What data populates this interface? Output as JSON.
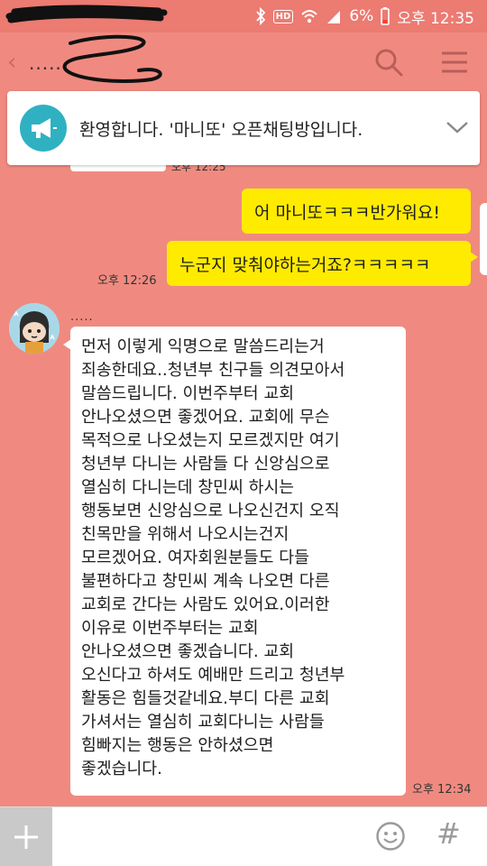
{
  "status_bar": {
    "battery": "6%",
    "time": "오후 12:35",
    "network_badge": "HD"
  },
  "header": {
    "title": ".....",
    "back_glyph": "‹",
    "icons": [
      "search-icon",
      "menu-icon"
    ]
  },
  "notice": {
    "text": "환영합니다. '마니또' 오픈채팅방입니다.",
    "icon": "megaphone-icon",
    "partial_time": "오후 12:25"
  },
  "messages_mine": [
    {
      "text": "어 마니또ㅋㅋㅋ반가워요!"
    },
    {
      "text": "누군지 맞춰야하는거죠?ㅋㅋㅋㅋㅋ",
      "time": "오후 12:26"
    }
  ],
  "message_other": {
    "sender": ".....",
    "lines": [
      "먼저 이렇게 익명으로 말씀드리는거",
      "죄송한데요..청년부 친구들 의견모아서",
      "말씀드립니다. 이번주부터 교회",
      "안나오셨으면 좋겠어요. 교회에 무슨",
      "목적으로 나오셨는지 모르겠지만 여기",
      "청년부 다니는 사람들 다 신앙심으로",
      "열심히 다니는데 창민씨 하시는",
      "행동보면 신앙심으로 나오신건지 오직",
      "친목만을 위해서 나오시는건지",
      "모르겠어요. 여자회원분들도 다들",
      "불편하다고 창민씨 계속 나오면 다른",
      "교회로 간다는 사람도 있어요.이러한",
      "이유로 이번주부터는 교회",
      "안나오셨으면 좋겠습니다. 교회",
      "오신다고 하셔도 예배만 드리고 청년부",
      "활동은 힘들것같네요.부디 다른 교회",
      "가셔서는 열심히 교회다니는 사람들",
      "힘빠지는 행동은 안하셨으면",
      "좋겠습니다."
    ],
    "time": "오후 12:34"
  },
  "input_bar": {
    "placeholder": "",
    "hash_glyph": "#",
    "icons": [
      "plus-icon",
      "emoji-icon"
    ]
  },
  "colors": {
    "background": "#f08a80",
    "my_bubble": "#ffeb00",
    "other_bubble": "#ffffff",
    "notice_icon": "#2fb1c2"
  }
}
